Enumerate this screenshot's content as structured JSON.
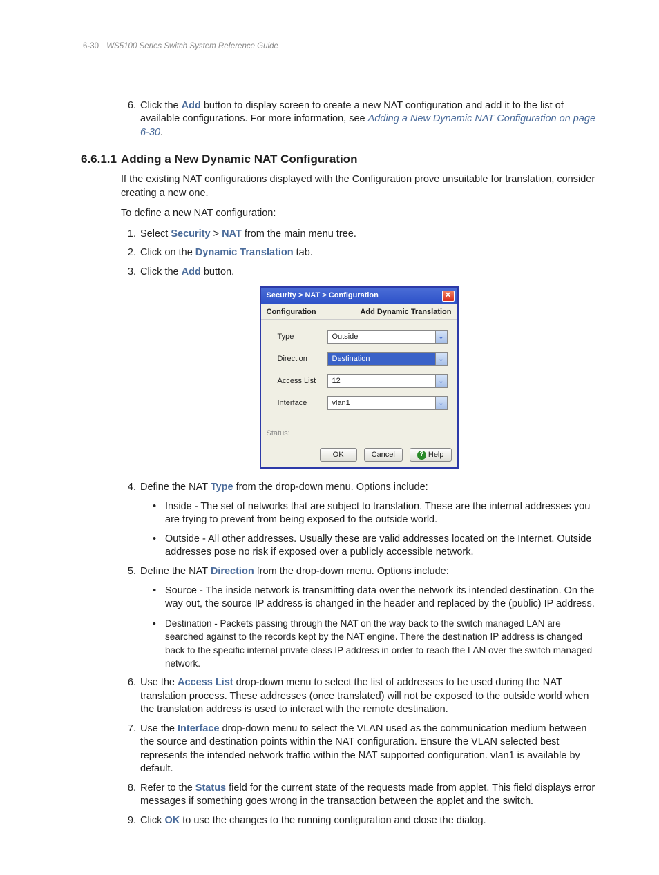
{
  "header": {
    "page_number": "6-30",
    "doc_title": "WS5100 Series Switch System Reference Guide"
  },
  "intro_step": {
    "number": "6.",
    "pre": "Click the ",
    "bold": "Add",
    "mid": " button to display screen to create a new NAT configuration and add it to the list of available configurations. For more information, see ",
    "link": "Adding a New Dynamic NAT Configuration on page 6-30",
    "post": "."
  },
  "section": {
    "number": "6.6.1.1",
    "title": "Adding a New Dynamic NAT Configuration"
  },
  "para1": "If the existing NAT configurations displayed with the Configuration prove unsuitable for translation, consider creating a new one.",
  "para2": "To define a new NAT configuration:",
  "steps_a": [
    {
      "no": "1.",
      "pre": "Select ",
      "b1": "Security",
      "mid": " > ",
      "b2": "NAT",
      "post": " from the main menu tree."
    },
    {
      "no": "2.",
      "pre": "Click on the ",
      "b1": "Dynamic Translation",
      "post": " tab."
    },
    {
      "no": "3.",
      "pre": "Click the ",
      "b1": "Add",
      "post": " button."
    }
  ],
  "dialog": {
    "title": "Security > NAT > Configuration",
    "sub_left": "Configuration",
    "sub_right": "Add Dynamic Translation",
    "close_glyph": "✕",
    "fields": {
      "type": {
        "label": "Type",
        "value": "Outside"
      },
      "direction": {
        "label": "Direction",
        "value": "Destination"
      },
      "access_list": {
        "label": "Access List",
        "value": "12"
      },
      "interface": {
        "label": "Interface",
        "value": "vlan1"
      }
    },
    "status_label": "Status:",
    "buttons": {
      "ok": "OK",
      "cancel": "Cancel",
      "help": "Help"
    }
  },
  "step4": {
    "no": "4.",
    "pre": "Define the NAT ",
    "bold": "Type",
    "post": " from the drop-down menu. Options include:",
    "bullets": [
      "Inside - The set of networks that are subject to translation. These are the internal addresses you are trying to prevent from being exposed to the outside world.",
      "Outside - All other addresses. Usually these are valid addresses located on the Internet. Outside addresses pose no risk if exposed over a publicly accessible network."
    ]
  },
  "step5": {
    "no": "5.",
    "pre": "Define the NAT ",
    "bold": "Direction",
    "post": " from the drop-down menu. Options include:",
    "bullets": [
      "Source - The inside network is transmitting data over the network its intended destination. On the way out, the source IP address is changed in the header and replaced by the (public) IP address.",
      "Destination - Packets passing through the NAT on the way back to the switch managed LAN are searched against to the records kept by the NAT engine. There the destination IP address is changed back to the specific internal private class IP address in order to reach the LAN over the switch managed network."
    ]
  },
  "step6": {
    "no": "6.",
    "pre": "Use the ",
    "bold": "Access List",
    "post": " drop-down menu to select the list of addresses to be used during the NAT translation process. These addresses (once translated) will not be exposed to the outside world when the translation address is used to interact with the remote destination."
  },
  "step7": {
    "no": "7.",
    "pre": "Use the ",
    "bold": "Interface",
    "post": " drop-down menu to select the VLAN used as the communication medium between the source and destination points within the NAT configuration. Ensure the VLAN selected best represents the intended network traffic within the NAT supported configuration. vlan1 is available by default."
  },
  "step8": {
    "no": "8.",
    "pre": "Refer to the ",
    "bold": "Status",
    "post": " field for the current state of the requests made from applet. This field displays error messages if something goes wrong in the transaction between the applet and the switch."
  },
  "step9": {
    "no": "9.",
    "pre": "Click ",
    "bold": "OK",
    "post": " to use the changes to the running configuration and close the dialog."
  },
  "glyphs": {
    "bullet": "•",
    "chev": "⌄"
  }
}
